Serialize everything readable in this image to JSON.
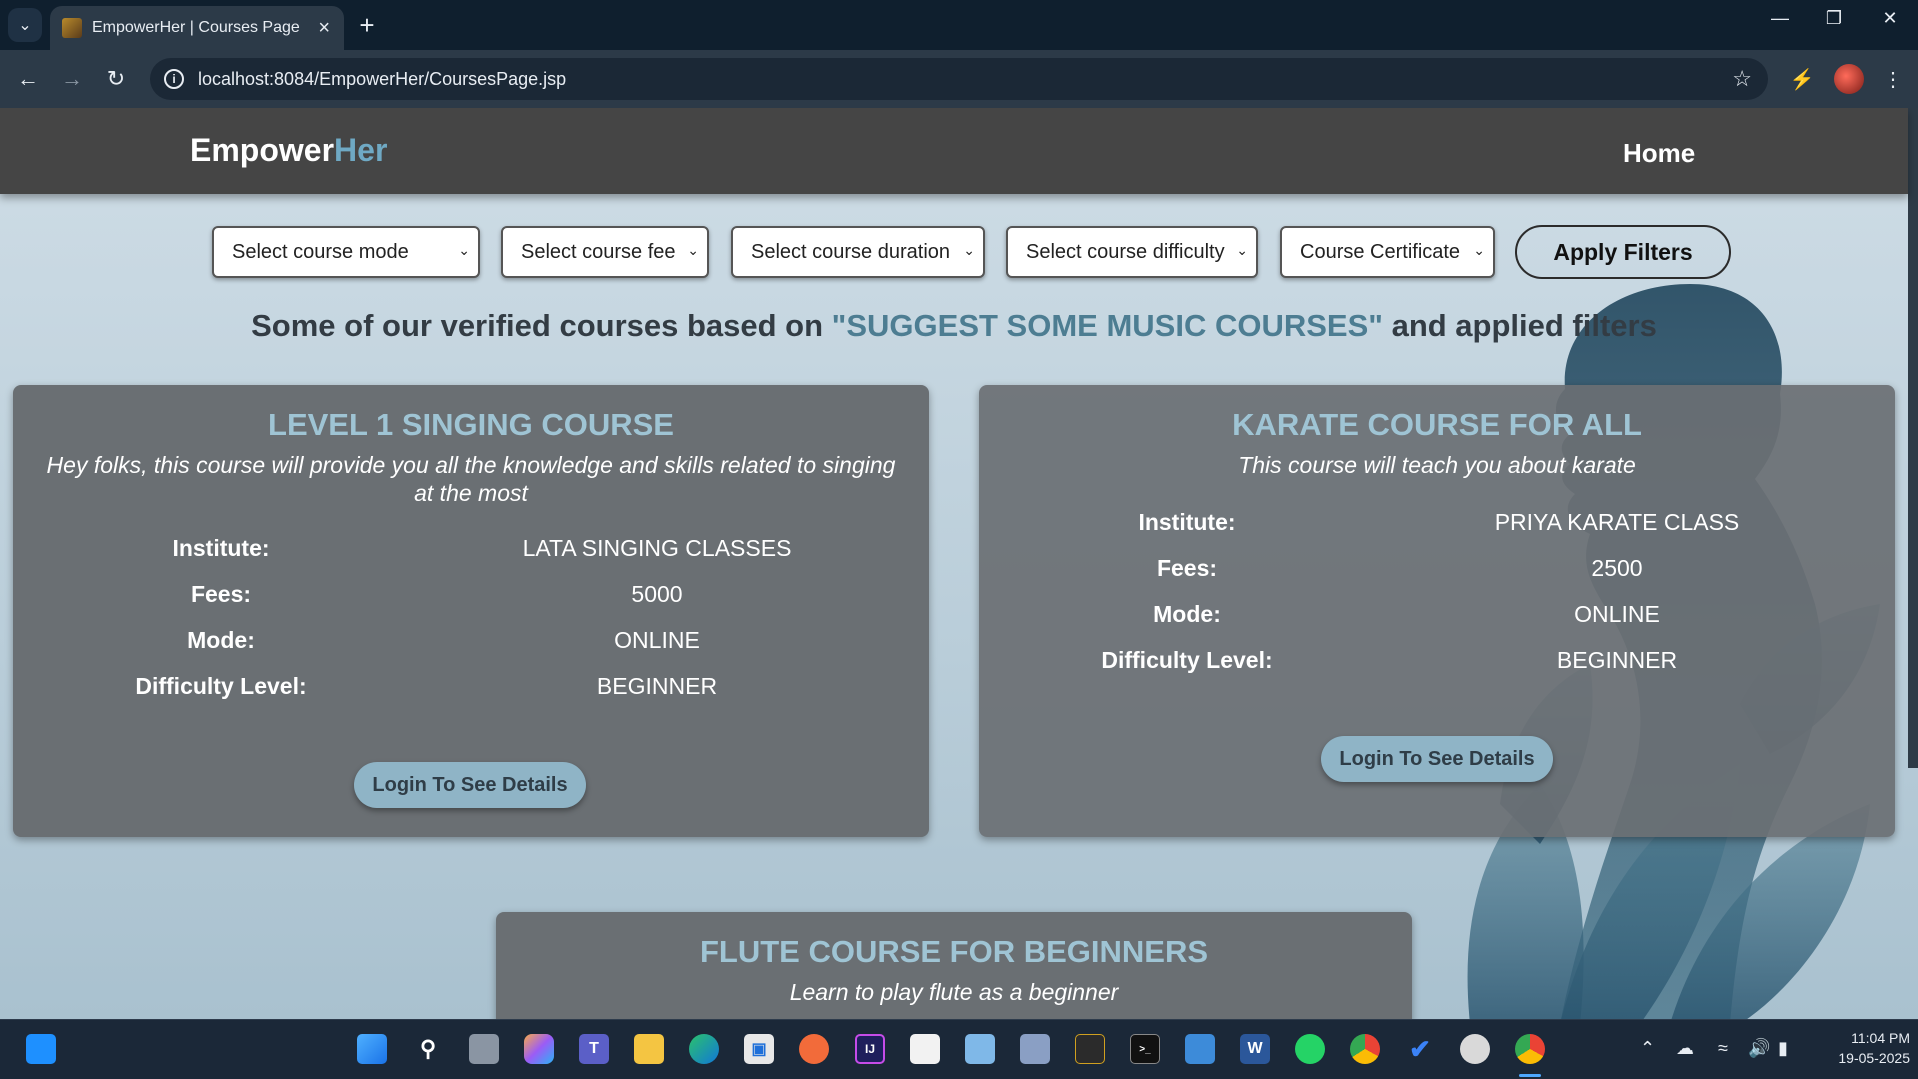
{
  "browser": {
    "tab_title": "EmpowerHer | Courses Page",
    "url": "localhost:8084/EmpowerHer/CoursesPage.jsp"
  },
  "header": {
    "brand_main": "Empower",
    "brand_accent": "Her",
    "nav_home": "Home"
  },
  "filters": {
    "mode": "Select course mode",
    "fee": "Select course fee",
    "duration": "Select course duration",
    "difficulty": "Select course difficulty",
    "certificate": "Course Certificate",
    "apply": "Apply Filters"
  },
  "headline": {
    "prefix": "Some of our verified courses based on ",
    "query": "\"SUGGEST SOME MUSIC COURSES\"",
    "suffix": " and applied filters"
  },
  "labels": {
    "institute": "Institute:",
    "fees": "Fees:",
    "mode": "Mode:",
    "difficulty": "Difficulty Level:"
  },
  "courses": [
    {
      "title": "LEVEL 1 SINGING COURSE",
      "description": "Hey folks, this course will provide you all the knowledge and skills related to singing at the most",
      "institute": "LATA SINGING CLASSES",
      "fees": "5000",
      "mode": "ONLINE",
      "difficulty": "BEGINNER",
      "button": "Login To See Details"
    },
    {
      "title": "KARATE COURSE FOR ALL",
      "description": "This course will teach you about karate",
      "institute": "PRIYA KARATE CLASS",
      "fees": "2500",
      "mode": "ONLINE",
      "difficulty": "BEGINNER",
      "button": "Login To See Details"
    },
    {
      "title": "FLUTE COURSE FOR BEGINNERS",
      "description": "Learn to play flute as a beginner"
    }
  ],
  "taskbar": {
    "time": "11:04 PM",
    "date": "19-05-2025"
  },
  "colors": {
    "header_bg": "#454545",
    "brand_accent": "#6fa9c4",
    "card_bg": "#6a6f73",
    "card_title": "#9fc4d4",
    "button_bg": "#8fb4c6"
  }
}
